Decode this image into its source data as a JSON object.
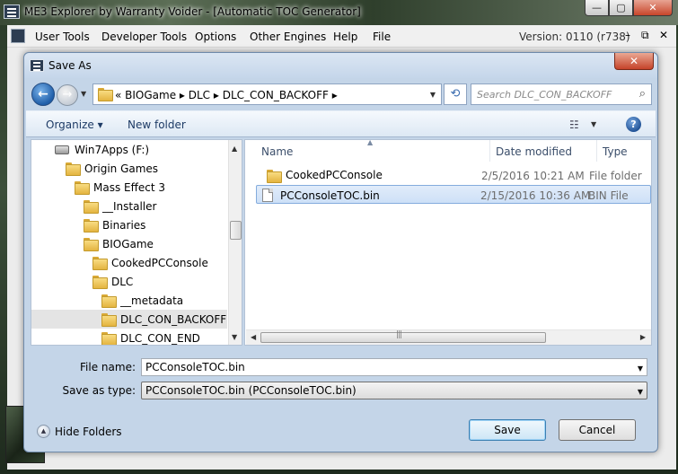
{
  "main_window": {
    "title": "ME3 Explorer by Warranty Voider - [Automatic TOC Generator]",
    "minimize": "—",
    "maximize": "▢",
    "close": "✕"
  },
  "menubar": {
    "items": [
      "User Tools",
      "Developer Tools",
      "Options",
      "Other Engines",
      "Help",
      "File"
    ],
    "version": "Version: 0110 (r738)",
    "mdi_min": "–",
    "mdi_restore": "⧉",
    "mdi_close": "✕"
  },
  "dialog": {
    "title": "Save As",
    "close": "✕",
    "address": {
      "crumbs": "«  BIOGame  ▸  DLC  ▸  DLC_CON_BACKOFF  ▸",
      "dropdown": "▼"
    },
    "search": {
      "placeholder": "Search DLC_CON_BACKOFF"
    },
    "toolbar": {
      "organize": "Organize ▾",
      "new_folder": "New folder",
      "help": "?"
    },
    "tree": [
      {
        "label": "Win7Apps (F:)",
        "kind": "drive",
        "indent": 0
      },
      {
        "label": "Origin Games",
        "kind": "folder",
        "indent": 1
      },
      {
        "label": "Mass Effect 3",
        "kind": "folder",
        "indent": 2
      },
      {
        "label": "__Installer",
        "kind": "folder",
        "indent": 3
      },
      {
        "label": "Binaries",
        "kind": "folder",
        "indent": 3
      },
      {
        "label": "BIOGame",
        "kind": "folder",
        "indent": 3
      },
      {
        "label": "CookedPCConsole",
        "kind": "folder",
        "indent": 4
      },
      {
        "label": "DLC",
        "kind": "folder",
        "indent": 4
      },
      {
        "label": "__metadata",
        "kind": "folder",
        "indent": 5
      },
      {
        "label": "DLC_CON_BACKOFF",
        "kind": "folder",
        "indent": 5,
        "selected": true
      },
      {
        "label": "DLC_CON_END",
        "kind": "folder",
        "indent": 5
      }
    ],
    "columns": {
      "name": "Name",
      "date": "Date modified",
      "type": "Type"
    },
    "files": [
      {
        "name": "CookedPCConsole",
        "date": "2/5/2016 10:21 AM",
        "type": "File folder",
        "kind": "folder"
      },
      {
        "name": "PCConsoleTOC.bin",
        "date": "2/15/2016 10:36 AM",
        "type": "BIN File",
        "kind": "file",
        "selected": true
      }
    ],
    "file_name_label": "File name:",
    "file_name_value": "PCConsoleTOC.bin",
    "save_type_label": "Save as type:",
    "save_type_value": "PCConsoleTOC.bin (PCConsoleTOC.bin)",
    "hide_folders": "Hide Folders",
    "save_button": "Save",
    "cancel_button": "Cancel"
  }
}
